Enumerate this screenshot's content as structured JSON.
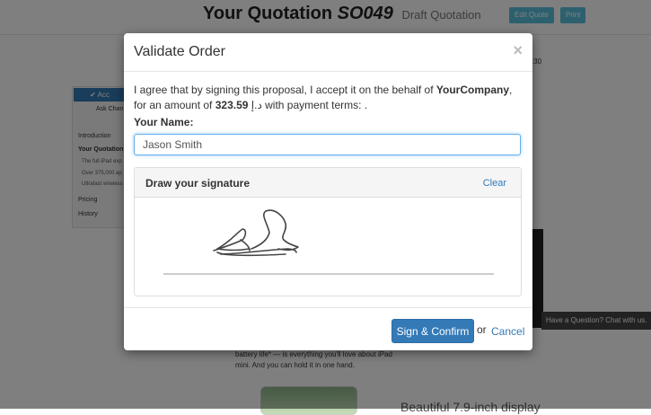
{
  "background": {
    "quotation_label": "Your Quotation",
    "quotation_number": "SO049",
    "quotation_status": "Draft Quotation",
    "edit_button": "Edit Quote",
    "print_button": "Print",
    "accept_button": "Acc",
    "ask_changes": "Ask Chan",
    "nav": [
      "Introduction",
      "Your Quotation",
      "The full iPad exp",
      "Over 375,000 ap",
      "Ultrafast wireless",
      "Pricing",
      "History"
    ],
    "time_fragment": ":30",
    "chat_text": "Have a Question? Chat with us.",
    "body_line1": "battery life* — is everything you'll love about iPad",
    "body_line2": "mini. And you can hold it in one hand.",
    "section_heading": "Beautiful 7.9-inch display"
  },
  "modal": {
    "title": "Validate Order",
    "close_symbol": "×",
    "intro_part1": "I agree that by signing this proposal, I accept it on the behalf of ",
    "company": "YourCompany",
    "intro_part2": ", for an amount of ",
    "amount": "323.59",
    "currency": "د.إ",
    "intro_part3": " with payment terms: .",
    "name_label": "Your Name:",
    "name_value": "Jason Smith",
    "signature_title": "Draw your signature",
    "clear_label": "Clear",
    "confirm_label": "Sign & Confirm",
    "or_label": "or",
    "cancel_label": "Cancel"
  },
  "colors": {
    "primary": "#337ab7",
    "overlay": "rgba(0,0,0,0.5)",
    "info_button": "#5bc0de"
  }
}
